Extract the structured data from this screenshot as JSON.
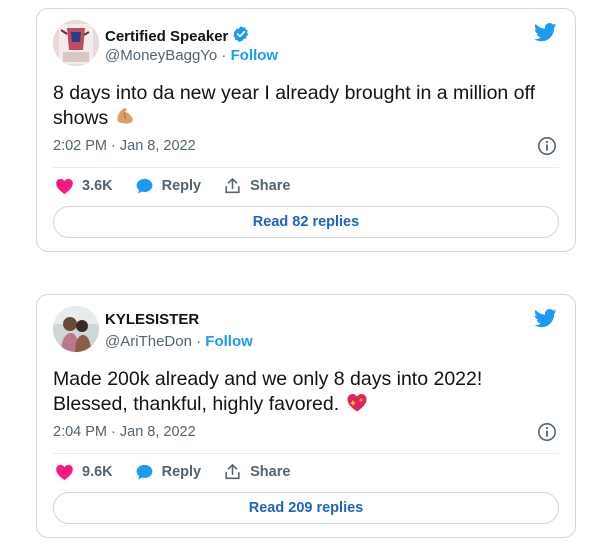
{
  "tweets": [
    {
      "display_name": "Certified Speaker",
      "verified": true,
      "handle": "@MoneyBaggYo",
      "separator": " · ",
      "follow_label": "Follow",
      "text": "8 days into da new year I already brought in a million off shows",
      "emoji": "flexed-biceps-emoji",
      "timestamp": "2:02 PM · Jan 8, 2022",
      "likes": "3.6K",
      "reply_label": "Reply",
      "share_label": "Share",
      "read_replies_label": "Read 82 replies"
    },
    {
      "display_name": "KYLESISTER",
      "verified": false,
      "handle": "@AriTheDon",
      "separator": " · ",
      "follow_label": "Follow",
      "text": "Made 200k already and we only 8 days into 2022! Blessed, thankful, highly favored.",
      "emoji": "sparkling-heart-emoji",
      "timestamp": "2:04 PM · Jan 8, 2022",
      "likes": "9.6K",
      "reply_label": "Reply",
      "share_label": "Share",
      "read_replies_label": "Read 209 replies"
    }
  ],
  "colors": {
    "accent": "#1d9bf0",
    "like": "#f91880",
    "reply": "#1d9bf0",
    "muted": "#536471",
    "read_link": "#1d64c8"
  }
}
